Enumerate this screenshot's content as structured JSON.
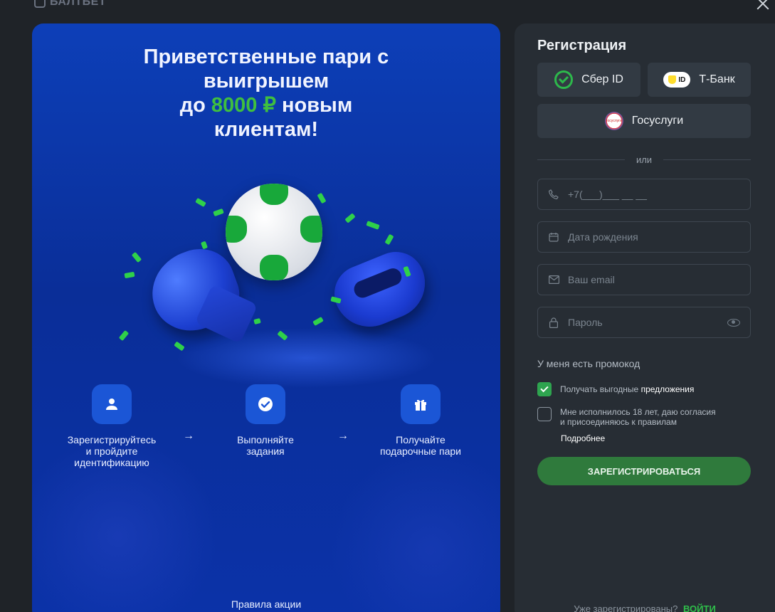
{
  "brand": {
    "name": "БАЛТБЕТ"
  },
  "promo": {
    "title_line1": "Приветственные пари с",
    "title_line2": "выигрышем",
    "title_prefix": "до",
    "title_amount": "8000 ₽",
    "title_suffix": "новым",
    "title_line4": "клиентам!",
    "steps": [
      {
        "icon": "user-icon",
        "text_line1": "Зарегистрируйтесь",
        "text_line2": "и пройдите",
        "text_line3": "идентификацию"
      },
      {
        "icon": "check-circle-icon",
        "text_line1": "Выполняйте",
        "text_line2": "задания",
        "text_line3": ""
      },
      {
        "icon": "gift-icon",
        "text_line1": "Получайте",
        "text_line2": "подарочные пари",
        "text_line3": ""
      }
    ],
    "arrow": "→",
    "rules_link": "Правила акции",
    "colors": {
      "accent": "#3fbf3f",
      "panel": "#0d3fb8"
    }
  },
  "registration": {
    "title": "Регистрация",
    "sber_label": "Сбер ID",
    "tbank_label": "Т-Банк",
    "tbank_badge": "ID",
    "gosuslugi_label": "Госуслуги",
    "gosuslugi_badge": "госуслуги",
    "divider": "или",
    "phone_placeholder": "+7(___)___ __ __",
    "birth_placeholder": "Дата рождения",
    "email_placeholder": "Ваш email",
    "password_placeholder": "Пароль",
    "promo_code_link": "У меня есть промокод",
    "offers_text": "Получать выгодные",
    "offers_highlight": "предложения",
    "offers_checked": true,
    "age_text_line1": "Мне исполнилось 18 лет, даю согласия",
    "age_text_line2": "и присоединяюсь к правилам",
    "age_checked": false,
    "more_link": "Подробнее",
    "submit_label": "ЗАРЕГИСТРИРОВАТЬСЯ",
    "already_text": "Уже зарегистрированы?",
    "login_link": "ВОЙТИ",
    "colors": {
      "submit": "#2f7a3c",
      "checkbox": "#2ea44f",
      "panel": "#272d34"
    }
  }
}
